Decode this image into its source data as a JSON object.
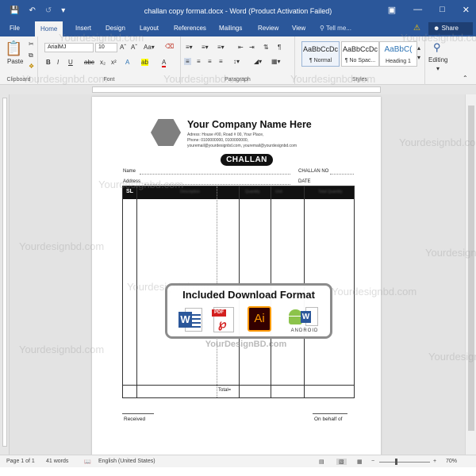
{
  "titlebar": {
    "save_icon": "save-icon",
    "undo_icon": "undo-icon",
    "redo_icon": "redo-icon",
    "title": "challan copy format.docx - Word (Product Activation Failed)"
  },
  "tabs": [
    "File",
    "Home",
    "Insert",
    "Design",
    "Layout",
    "References",
    "Mailings",
    "Review",
    "View"
  ],
  "tellme": "Tell me...",
  "share": "Share",
  "ribbon": {
    "clipboard": {
      "paste": "Paste",
      "label": "Clipboard"
    },
    "font": {
      "name": "ArialMJ",
      "size": "10",
      "label": "Font"
    },
    "paragraph": {
      "label": "Paragraph"
    },
    "styles": {
      "label": "Styles",
      "items": [
        {
          "sample": "AaBbCcDc",
          "name": "¶ Normal"
        },
        {
          "sample": "AaBbCcDc",
          "name": "¶ No Spac..."
        },
        {
          "sample": "AaBbC(",
          "name": "Heading 1"
        }
      ]
    },
    "editing": {
      "label": "Editing"
    }
  },
  "document": {
    "company": "Your Company Name Here",
    "address_line1": "Adress: House #00, Road # 00, Your Place,",
    "address_line2": "Phone: 0100000000, 0100000000,",
    "address_line3": "youremail@yourdesignbd.com, youremail@yourdesignbd.com",
    "challan": "CHALLAN",
    "name_label": "Name",
    "challan_no_label": "CHALLAN NO",
    "address_label": "Address",
    "date_label": "DATE",
    "table": {
      "sl": "SL",
      "headers": [
        "Description",
        "Quantity",
        "Unit",
        "Unit Price",
        "Total Quantity"
      ],
      "total": "Total="
    },
    "received": "Received",
    "on_behalf": "On behalf of"
  },
  "watermark": "Yourdesignbd.com",
  "badge": {
    "title": "Included Download Format",
    "pdf_tag": "PDF",
    "ai_text": "Ai",
    "word_text": "W",
    "android_text": "ANDROID",
    "brand": "YourDesignBD.com"
  },
  "statusbar": {
    "page": "Page 1 of 1",
    "words": "41 words",
    "language": "English (United States)",
    "zoom": "70%",
    "zoom_minus": "−",
    "zoom_plus": "+"
  }
}
